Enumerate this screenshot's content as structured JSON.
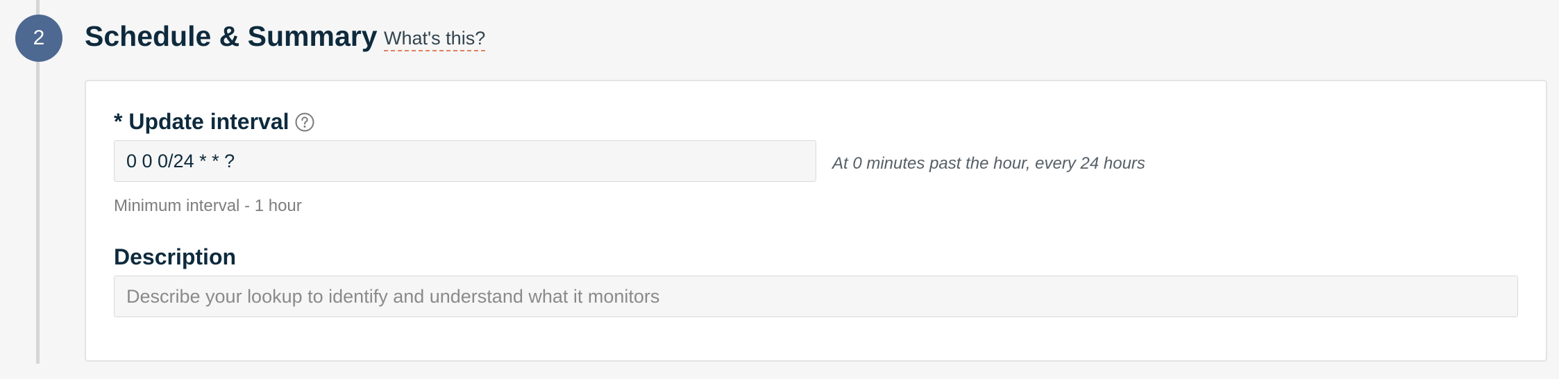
{
  "step": {
    "number": "2",
    "title": "Schedule & Summary",
    "whats_this_link": "What's this?"
  },
  "update_interval": {
    "label": "* Update interval",
    "value": "0 0 0/24 * * ?",
    "human_readable": "At 0 minutes past the hour, every 24 hours",
    "helper_text": "Minimum interval - 1 hour",
    "help_icon": "question-circle-icon"
  },
  "description": {
    "label": "Description",
    "placeholder": "Describe your lookup to identify and understand what it monitors",
    "value": ""
  },
  "colors": {
    "step_circle": "#4d6891",
    "heading": "#0e2a3d",
    "link_underline": "#e0805a"
  }
}
